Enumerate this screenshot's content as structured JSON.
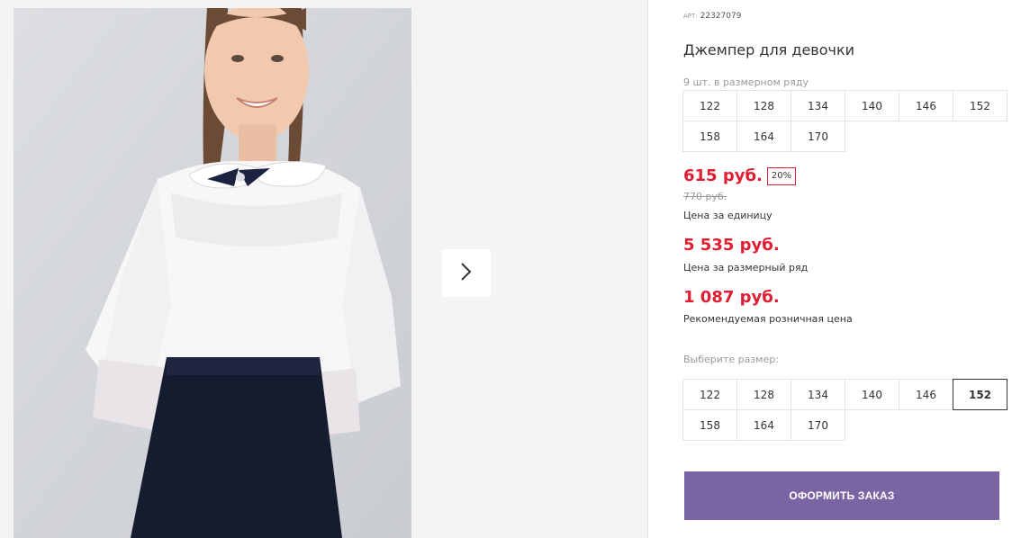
{
  "product": {
    "art_label": "АРТ:",
    "art_number": "22327079",
    "title": "Джемпер для девочки"
  },
  "size_range": {
    "note": "9 шт. в размерном ряду",
    "sizes": [
      "122",
      "128",
      "134",
      "140",
      "146",
      "152",
      "158",
      "164",
      "170"
    ]
  },
  "pricing": {
    "unit_price": "615 руб.",
    "discount": "20%",
    "old_price": "770 руб.",
    "unit_caption": "Цена за единицу",
    "range_price": "5 535 руб.",
    "range_caption": "Цена за размерный ряд",
    "retail_price": "1 087 руб.",
    "retail_caption": "Рекомендуемая розничная цена"
  },
  "size_select": {
    "label": "Выберите размер:",
    "sizes": [
      "122",
      "128",
      "134",
      "140",
      "146",
      "152",
      "158",
      "164",
      "170"
    ],
    "selected": "152"
  },
  "order_button": {
    "label": "ОФОРМИТЬ ЗАКАЗ"
  },
  "gallery": {
    "next_icon": "chevron-right-icon"
  },
  "colors": {
    "price": "#e01d31",
    "button": "#7a64a3"
  }
}
